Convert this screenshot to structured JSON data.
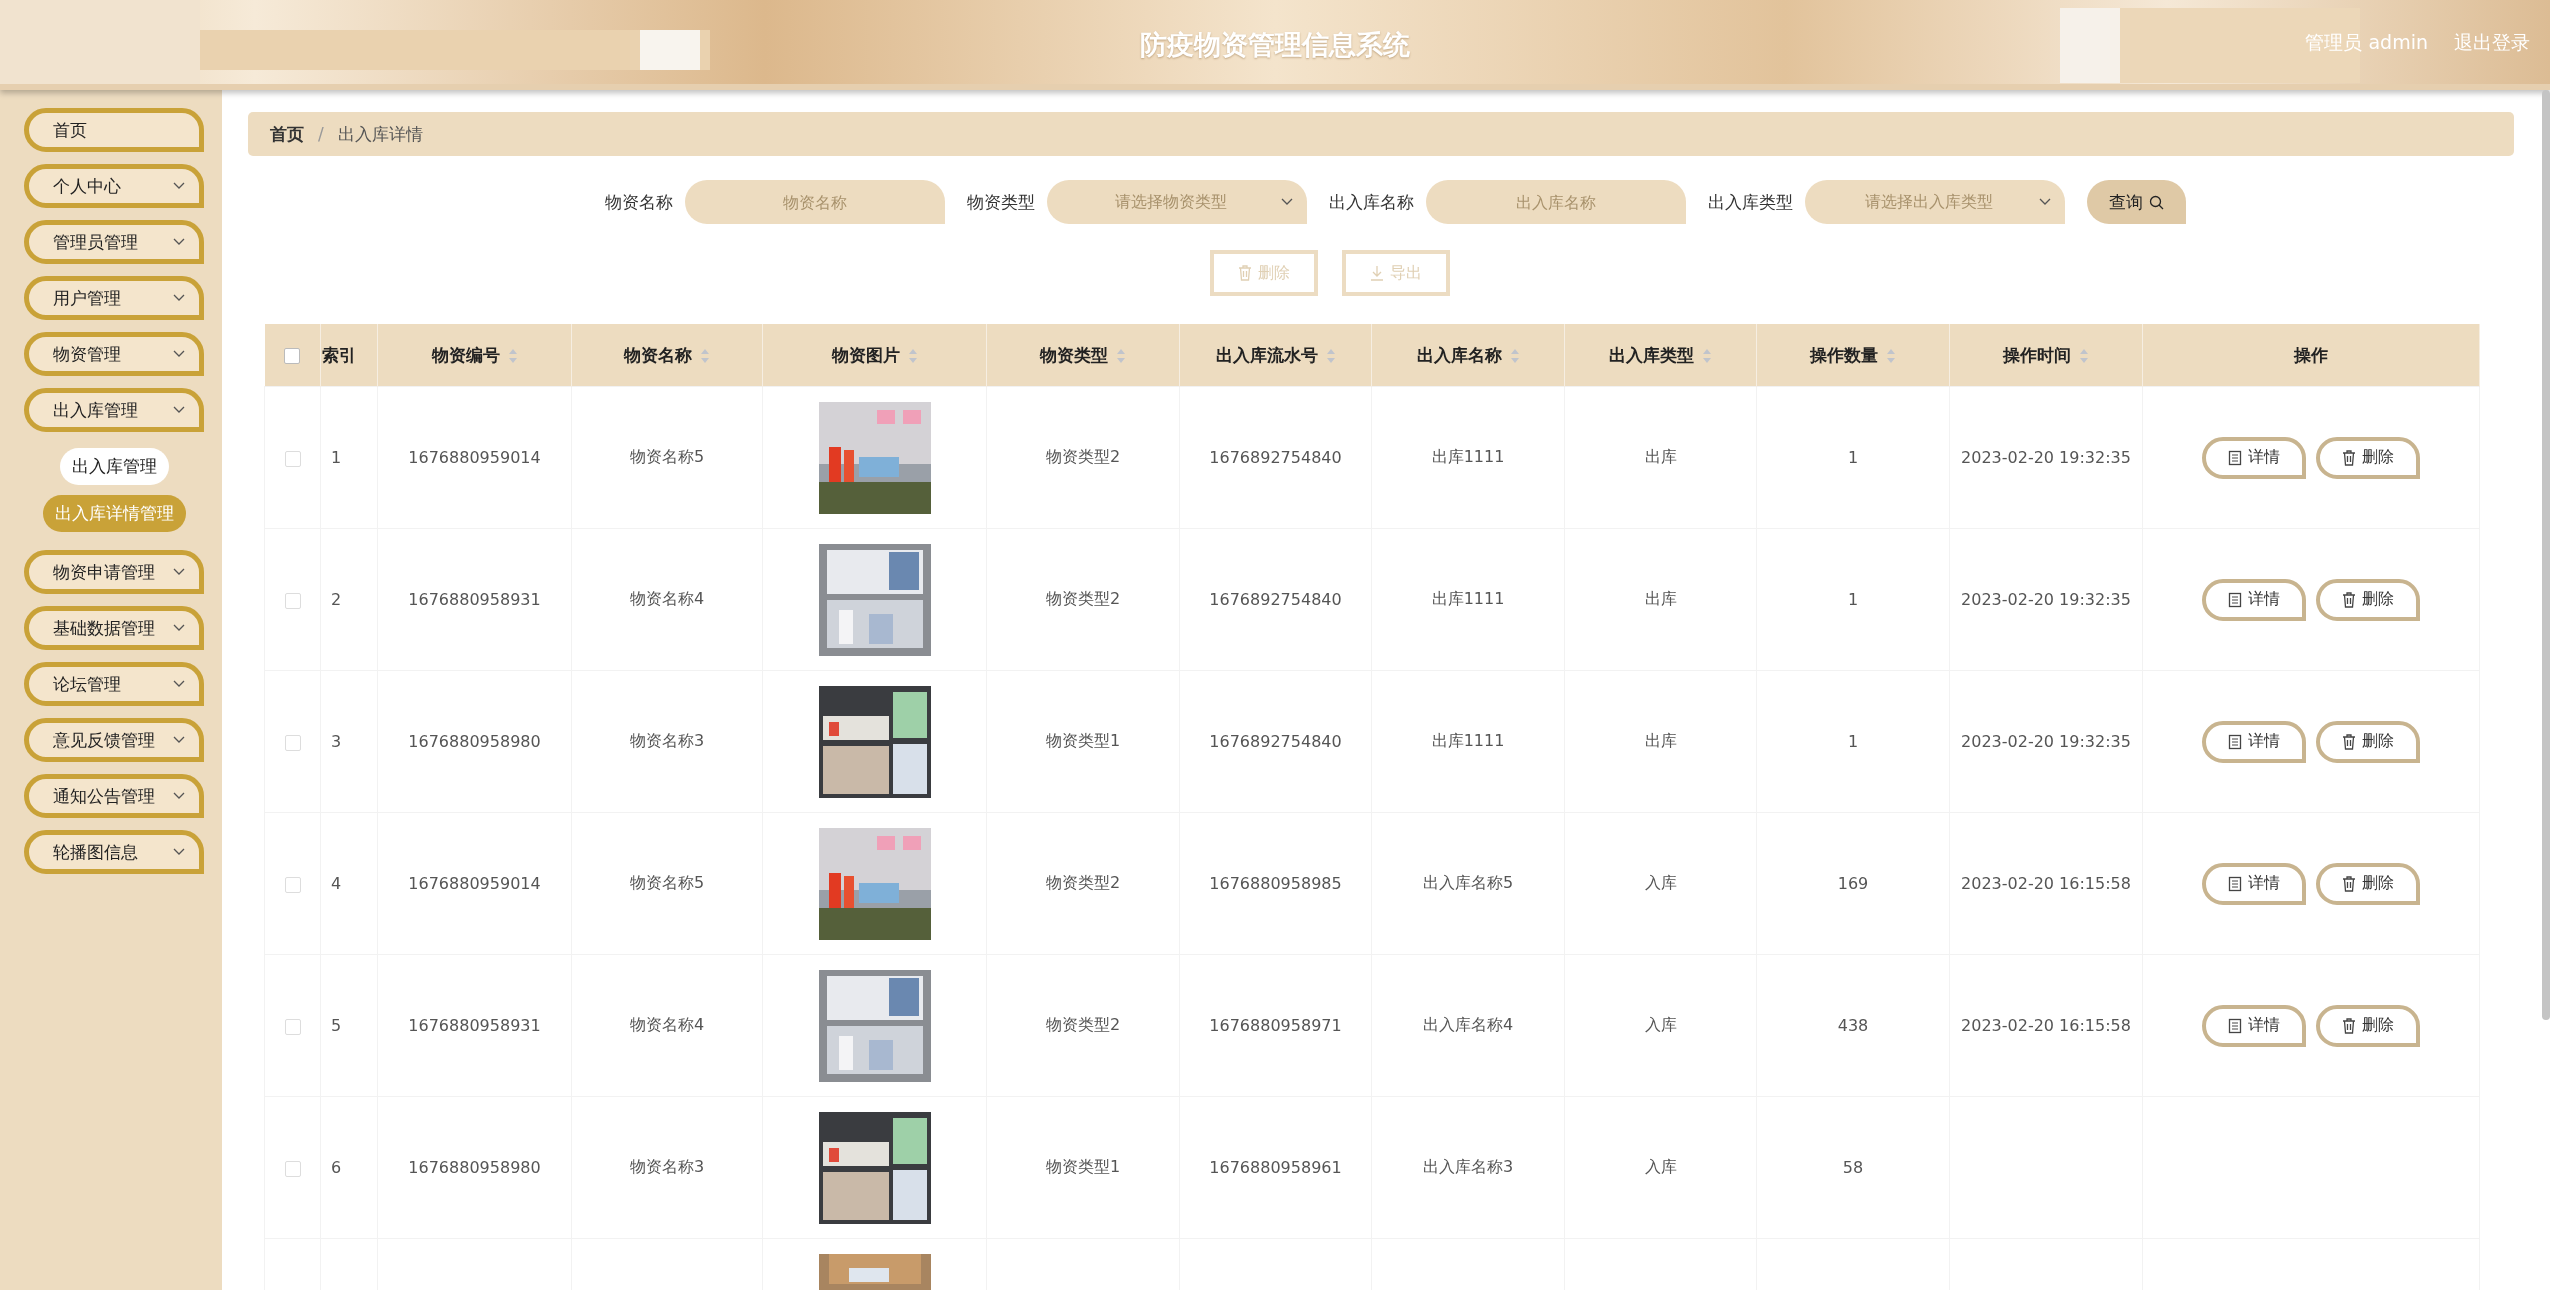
{
  "header": {
    "title": "防疫物资管理信息系统",
    "user": "管理员 admin",
    "logout": "退出登录"
  },
  "sidebar": {
    "items": [
      {
        "label": "首页",
        "expandable": false
      },
      {
        "label": "个人中心",
        "expandable": true
      },
      {
        "label": "管理员管理",
        "expandable": true
      },
      {
        "label": "用户管理",
        "expandable": true
      },
      {
        "label": "物资管理",
        "expandable": true
      },
      {
        "label": "出入库管理",
        "expandable": true,
        "children": [
          {
            "label": "出入库管理",
            "selected": false
          },
          {
            "label": "出入库详情管理",
            "selected": true
          }
        ]
      },
      {
        "label": "物资申请管理",
        "expandable": true
      },
      {
        "label": "基础数据管理",
        "expandable": true
      },
      {
        "label": "论坛管理",
        "expandable": true
      },
      {
        "label": "意见反馈管理",
        "expandable": true
      },
      {
        "label": "通知公告管理",
        "expandable": true
      },
      {
        "label": "轮播图信息",
        "expandable": true
      }
    ]
  },
  "breadcrumb": {
    "items": [
      "首页",
      "出入库详情"
    ],
    "separator": "/"
  },
  "filters": [
    {
      "kind": "input",
      "label": "物资名称",
      "placeholder": "物资名称"
    },
    {
      "kind": "select",
      "label": "物资类型",
      "placeholder": "请选择物资类型"
    },
    {
      "kind": "input",
      "label": "出入库名称",
      "placeholder": "出入库名称"
    },
    {
      "kind": "select",
      "label": "出入库类型",
      "placeholder": "请选择出入库类型"
    }
  ],
  "search_button": "查询",
  "toolbar": [
    {
      "kind": "delete",
      "label": "删除",
      "disabled": true
    },
    {
      "kind": "export",
      "label": "导出",
      "disabled": true
    }
  ],
  "table": {
    "select_all": false,
    "columns": [
      {
        "label": "索引",
        "sortable": false
      },
      {
        "label": "物资编号",
        "sortable": true
      },
      {
        "label": "物资名称",
        "sortable": true
      },
      {
        "label": "物资图片",
        "sortable": true
      },
      {
        "label": "物资类型",
        "sortable": true
      },
      {
        "label": "出入库流水号",
        "sortable": true
      },
      {
        "label": "出入库名称",
        "sortable": true
      },
      {
        "label": "出入库类型",
        "sortable": true
      },
      {
        "label": "操作数量",
        "sortable": true
      },
      {
        "label": "操作时间",
        "sortable": true
      },
      {
        "label": "操作",
        "sortable": false
      }
    ],
    "rows": [
      {
        "checked": false,
        "cells": [
          "1",
          "1676880959014",
          "物资名称5",
          null,
          "物资类型2",
          "1676892754840",
          "出库1111",
          "出库",
          "1",
          "2023-02-20 19:32:35"
        ],
        "image": {
          "kind": "picture"
        },
        "actions": [
          "详情",
          "删除"
        ]
      },
      {
        "checked": false,
        "cells": [
          "2",
          "1676880958931",
          "物资名称4",
          null,
          "物资类型2",
          "1676892754840",
          "出库1111",
          "出库",
          "1",
          "2023-02-20 19:32:35"
        ],
        "image": {
          "kind": "picture"
        },
        "actions": [
          "详情",
          "删除"
        ]
      },
      {
        "checked": false,
        "cells": [
          "3",
          "1676880958980",
          "物资名称3",
          null,
          "物资类型1",
          "1676892754840",
          "出库1111",
          "出库",
          "1",
          "2023-02-20 19:32:35"
        ],
        "image": {
          "kind": "picture"
        },
        "actions": [
          "详情",
          "删除"
        ]
      },
      {
        "checked": false,
        "cells": [
          "4",
          "1676880959014",
          "物资名称5",
          null,
          "物资类型2",
          "1676880958985",
          "出入库名称5",
          "入库",
          "169",
          "2023-02-20 16:15:58"
        ],
        "image": {
          "kind": "picture"
        },
        "actions": [
          "详情",
          "删除"
        ]
      },
      {
        "checked": false,
        "cells": [
          "5",
          "1676880958931",
          "物资名称4",
          null,
          "物资类型2",
          "1676880958971",
          "出入库名称4",
          "入库",
          "438",
          "2023-02-20 16:15:58"
        ],
        "image": {
          "kind": "picture"
        },
        "actions": [
          "详情",
          "删除"
        ]
      },
      {
        "checked": false,
        "cells": [
          "6",
          "1676880958980",
          "物资名称3",
          null,
          "物资类型1",
          "1676880958961",
          "出入库名称3",
          "入库",
          "58",
          null
        ],
        "image": {
          "kind": "picture"
        }
      },
      {
        "image": {
          "kind": "picture"
        }
      }
    ]
  }
}
